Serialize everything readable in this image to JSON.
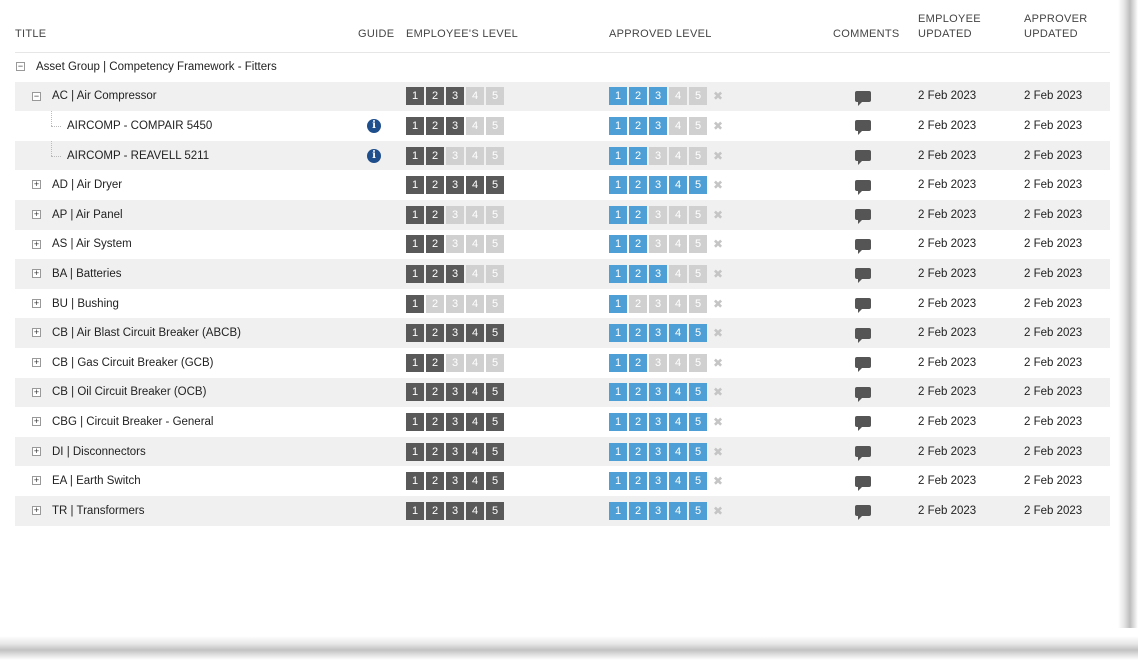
{
  "columns": {
    "title": "TITLE",
    "guide": "GUIDE",
    "employee_level": "EMPLOYEE'S LEVEL",
    "approved_level": "APPROVED LEVEL",
    "comments": "COMMENTS",
    "employee_updated": [
      "EMPLOYEE",
      "UPDATED"
    ],
    "approver_updated": [
      "APPROVER",
      "UPDATED"
    ]
  },
  "colors": {
    "employee_on": "#595959",
    "approved_on": "#4d9fd6",
    "level_off": "#d0d0d0",
    "info_icon": "#1f4e8c"
  },
  "level_labels": [
    "1",
    "2",
    "3",
    "4",
    "5"
  ],
  "rows": [
    {
      "title": "Asset Group | Competency Framework - Fitters",
      "depth": 0,
      "toggle": "minus",
      "group": true
    },
    {
      "title": "AC | Air Compressor",
      "depth": 1,
      "toggle": "minus",
      "emp": 3,
      "app": 3,
      "guide": false,
      "emp_updated": "2 Feb 2023",
      "app_updated": "2 Feb 2023"
    },
    {
      "title": "AIRCOMP - COMPAIR 5450",
      "depth": 2,
      "toggle": "",
      "emp": 3,
      "app": 3,
      "guide": true,
      "emp_updated": "2 Feb 2023",
      "app_updated": "2 Feb 2023"
    },
    {
      "title": "AIRCOMP - REAVELL 5211",
      "depth": 2,
      "toggle": "",
      "emp": 2,
      "app": 2,
      "guide": true,
      "emp_updated": "2 Feb 2023",
      "app_updated": "2 Feb 2023"
    },
    {
      "title": "AD | Air Dryer",
      "depth": 1,
      "toggle": "plus",
      "emp": 5,
      "app": 5,
      "guide": false,
      "emp_updated": "2 Feb 2023",
      "app_updated": "2 Feb 2023"
    },
    {
      "title": "AP | Air Panel",
      "depth": 1,
      "toggle": "plus",
      "emp": 2,
      "app": 2,
      "guide": false,
      "emp_updated": "2 Feb 2023",
      "app_updated": "2 Feb 2023"
    },
    {
      "title": "AS | Air System",
      "depth": 1,
      "toggle": "plus",
      "emp": 2,
      "app": 2,
      "guide": false,
      "emp_updated": "2 Feb 2023",
      "app_updated": "2 Feb 2023"
    },
    {
      "title": "BA | Batteries",
      "depth": 1,
      "toggle": "plus",
      "emp": 3,
      "app": 3,
      "guide": false,
      "emp_updated": "2 Feb 2023",
      "app_updated": "2 Feb 2023"
    },
    {
      "title": "BU | Bushing",
      "depth": 1,
      "toggle": "plus",
      "emp": 1,
      "app": 1,
      "guide": false,
      "emp_updated": "2 Feb 2023",
      "app_updated": "2 Feb 2023"
    },
    {
      "title": "CB | Air Blast Circuit Breaker (ABCB)",
      "depth": 1,
      "toggle": "plus",
      "emp": 5,
      "app": 5,
      "guide": false,
      "emp_updated": "2 Feb 2023",
      "app_updated": "2 Feb 2023"
    },
    {
      "title": "CB | Gas Circuit Breaker (GCB)",
      "depth": 1,
      "toggle": "plus",
      "emp": 2,
      "app": 2,
      "guide": false,
      "emp_updated": "2 Feb 2023",
      "app_updated": "2 Feb 2023"
    },
    {
      "title": "CB | Oil Circuit Breaker (OCB)",
      "depth": 1,
      "toggle": "plus",
      "emp": 5,
      "app": 5,
      "guide": false,
      "emp_updated": "2 Feb 2023",
      "app_updated": "2 Feb 2023"
    },
    {
      "title": "CBG | Circuit Breaker - General",
      "depth": 1,
      "toggle": "plus",
      "emp": 5,
      "app": 5,
      "guide": false,
      "emp_updated": "2 Feb 2023",
      "app_updated": "2 Feb 2023"
    },
    {
      "title": "DI | Disconnectors",
      "depth": 1,
      "toggle": "plus",
      "emp": 5,
      "app": 5,
      "guide": false,
      "emp_updated": "2 Feb 2023",
      "app_updated": "2 Feb 2023"
    },
    {
      "title": "EA | Earth Switch",
      "depth": 1,
      "toggle": "plus",
      "emp": 5,
      "app": 5,
      "guide": false,
      "emp_updated": "2 Feb 2023",
      "app_updated": "2 Feb 2023"
    },
    {
      "title": "TR | Transformers",
      "depth": 1,
      "toggle": "plus",
      "emp": 5,
      "app": 5,
      "guide": false,
      "emp_updated": "2 Feb 2023",
      "app_updated": "2 Feb 2023"
    }
  ]
}
